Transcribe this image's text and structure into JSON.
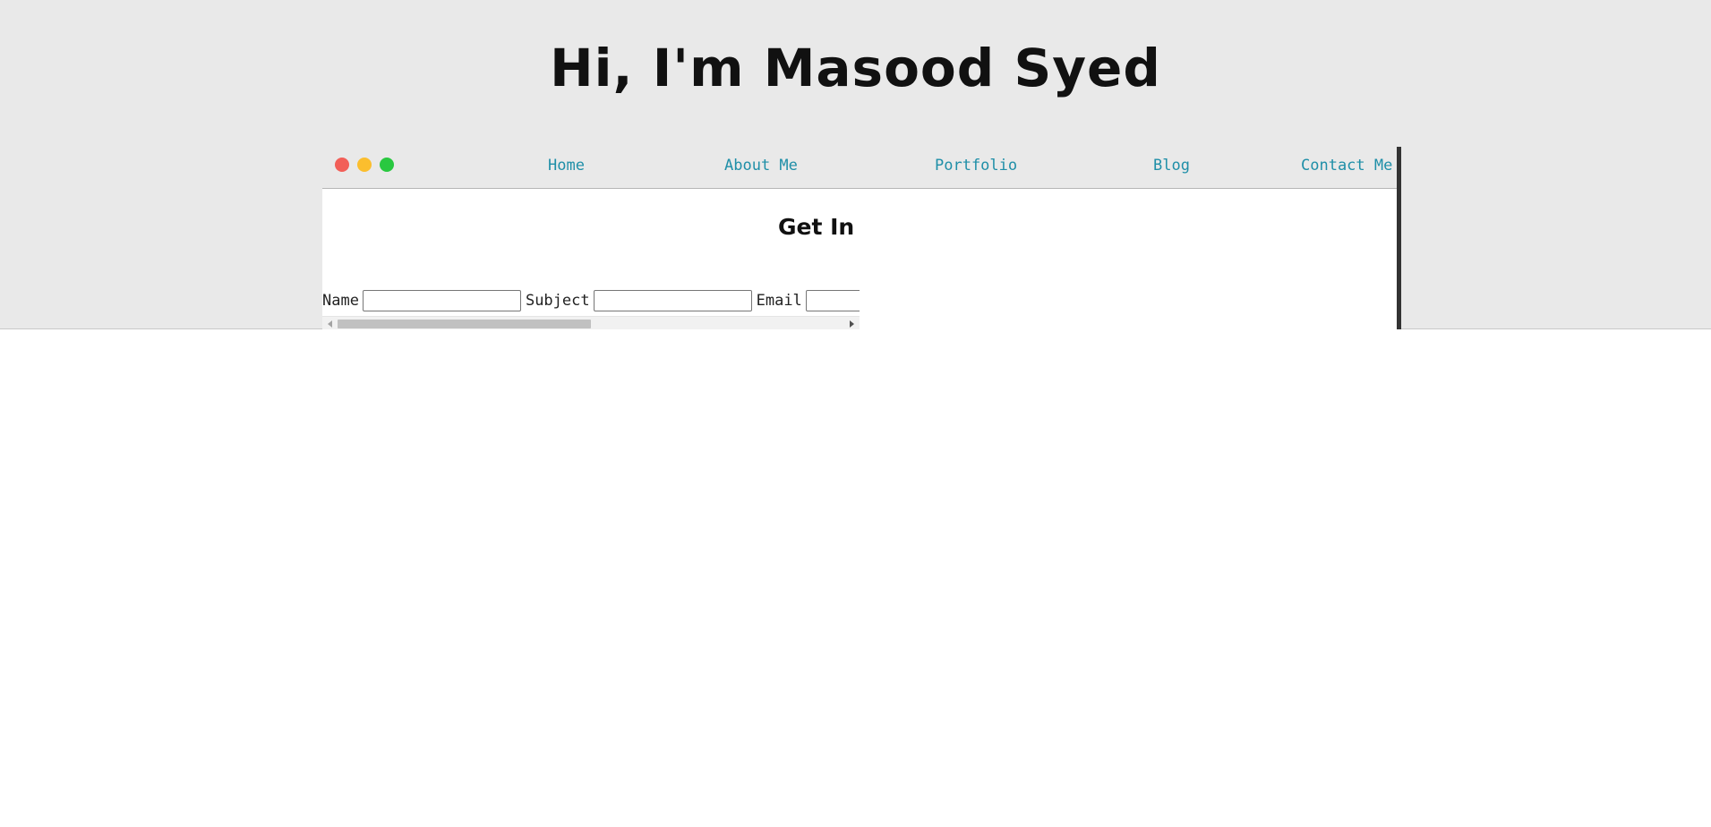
{
  "header": {
    "title": "Hi, I'm Masood Syed"
  },
  "window": {
    "controls": [
      "close-icon",
      "minimize-icon",
      "maximize-icon"
    ],
    "control_colors": {
      "close": "#f25f58",
      "minimize": "#fbbe2e",
      "maximize": "#29c840"
    }
  },
  "nav": {
    "items": [
      {
        "label": "Home"
      },
      {
        "label": "About Me"
      },
      {
        "label": "Portfolio"
      },
      {
        "label": "Blog"
      },
      {
        "label": "Contact Me"
      }
    ],
    "link_color": "#1f8fa8"
  },
  "contact": {
    "heading": "Get In",
    "fields": [
      {
        "label": "Name",
        "value": "",
        "placeholder": ""
      },
      {
        "label": "Subject",
        "value": "",
        "placeholder": ""
      },
      {
        "label": "Email",
        "value": "",
        "placeholder": ""
      }
    ]
  },
  "scrollbar": {
    "arrow_left_icon": "chevron-left-icon",
    "arrow_right_icon": "chevron-right-icon"
  }
}
